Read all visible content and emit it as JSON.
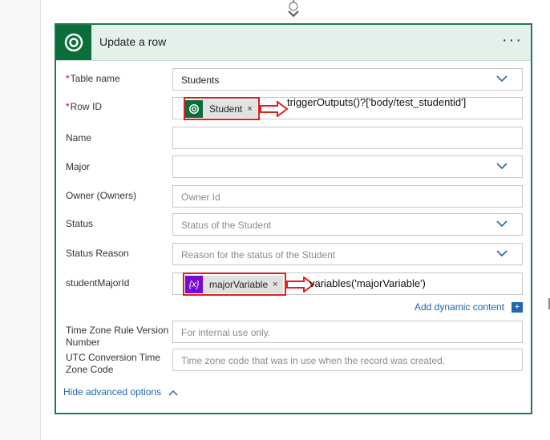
{
  "card": {
    "title": "Update a row",
    "more_label": "···"
  },
  "fields": {
    "table_name": {
      "label": "Table name",
      "value": "Students"
    },
    "row_id": {
      "label": "Row ID",
      "token": "Student",
      "annotation": "triggerOutputs()?['body/test_studentid']"
    },
    "name": {
      "label": "Name"
    },
    "major": {
      "label": "Major"
    },
    "owner": {
      "label": "Owner (Owners)",
      "placeholder": "Owner Id"
    },
    "status": {
      "label": "Status",
      "placeholder": "Status of the Student"
    },
    "status_reason": {
      "label": "Status Reason",
      "placeholder": "Reason for the status of the Student"
    },
    "student_major_id": {
      "label": "studentMajorId",
      "token": "majorVariable",
      "annotation": "variables('majorVariable')"
    },
    "tz_rule": {
      "label_line1": "Time Zone Rule Version",
      "label_line2": "Number",
      "placeholder": "For internal use only."
    },
    "utc_conv": {
      "label_line1": "UTC Conversion Time",
      "label_line2": "Zone Code",
      "placeholder": "Time zone code that was in use when the record was created."
    }
  },
  "required_marker": "*",
  "token_remove": "×",
  "links": {
    "add_dynamic_content": "Add dynamic content",
    "add_dynamic_plus": "+",
    "hide_advanced": "Hide advanced options"
  },
  "colors": {
    "card_border": "#1f7a4c",
    "header_bg": "#e4f1ea",
    "header_icon_bg": "#0b6e3a",
    "link": "#1f66b3",
    "annotation_red": "#e0201c",
    "variable_purple": "#770bd6"
  }
}
